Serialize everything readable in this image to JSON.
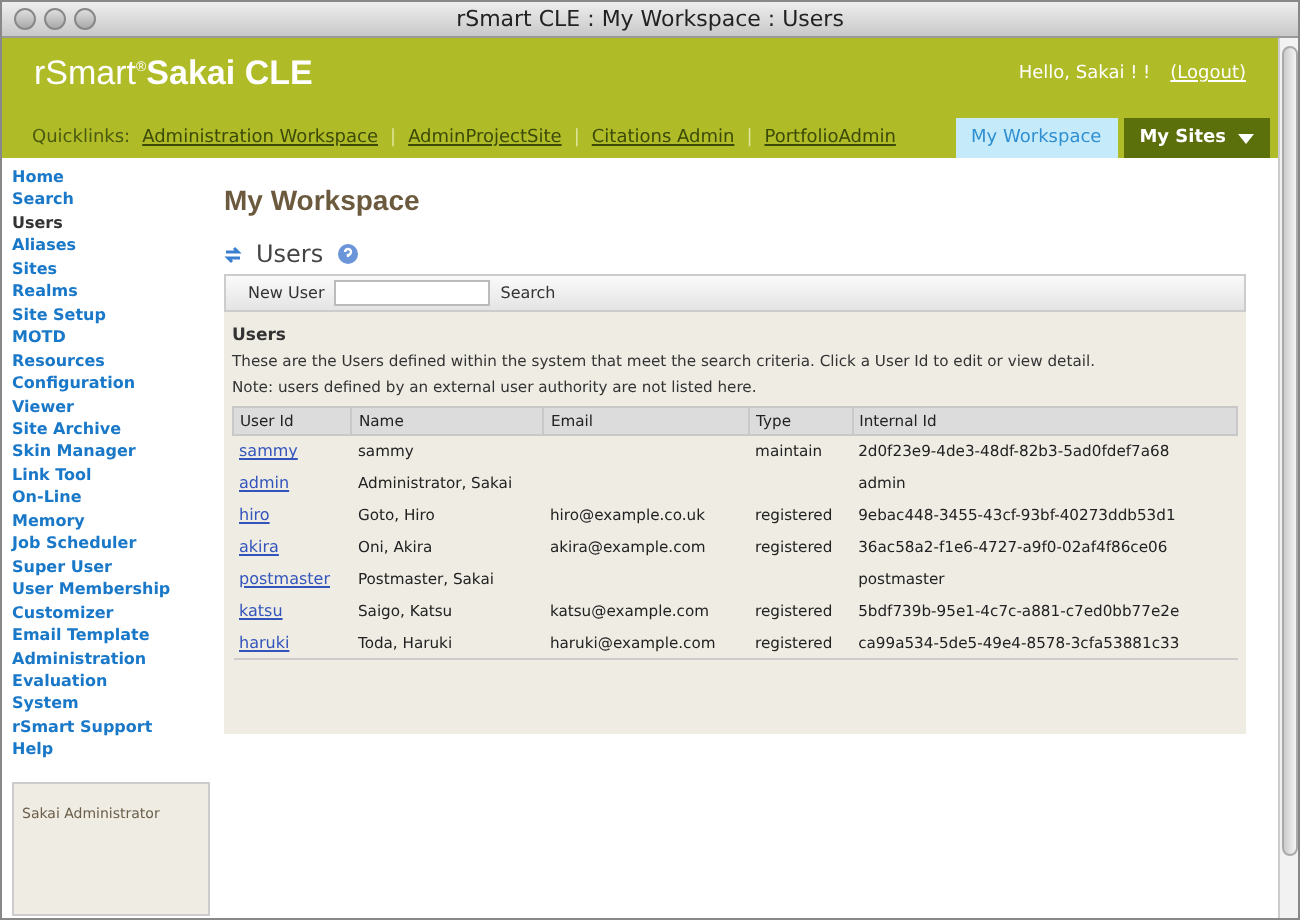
{
  "window": {
    "title": "rSmart CLE : My Workspace : Users"
  },
  "header": {
    "logo_light": "rSmart",
    "logo_mark": "®",
    "logo_bold": "Sakai CLE",
    "greeting": "Hello, Sakai ! !",
    "logout": "(Logout)"
  },
  "quicklinks": {
    "label": "Quicklinks:",
    "links": [
      "Administration Workspace",
      "AdminProjectSite",
      "Citations Admin",
      "PortfolioAdmin"
    ],
    "separator": "|"
  },
  "site_tabs": [
    {
      "label": "My Workspace",
      "selected": true,
      "caret": false
    },
    {
      "label": "My Sites",
      "selected": false,
      "caret": true
    }
  ],
  "sidebar": {
    "items": [
      {
        "label": "Home",
        "selected": false
      },
      {
        "label": "Search",
        "selected": false
      },
      {
        "label": "Users",
        "selected": true
      },
      {
        "label": "Aliases",
        "selected": false
      },
      {
        "label": "Sites",
        "selected": false
      },
      {
        "label": "Realms",
        "selected": false
      },
      {
        "label": "Site Setup",
        "selected": false
      },
      {
        "label": "MOTD",
        "selected": false
      },
      {
        "label": "Resources",
        "selected": false
      },
      {
        "label": "Configuration",
        "selected": false
      },
      {
        "label": "Viewer",
        "selected": false
      },
      {
        "label": "Site Archive",
        "selected": false
      },
      {
        "label": "Skin Manager",
        "selected": false
      },
      {
        "label": "Link Tool",
        "selected": false
      },
      {
        "label": "On-Line",
        "selected": false
      },
      {
        "label": "Memory",
        "selected": false
      },
      {
        "label": "Job Scheduler",
        "selected": false
      },
      {
        "label": "Super User",
        "selected": false
      },
      {
        "label": "User Membership",
        "selected": false
      },
      {
        "label": "Customizer",
        "selected": false
      },
      {
        "label": "Email Template",
        "selected": false
      },
      {
        "label": "Administration",
        "selected": false
      },
      {
        "label": "Evaluation",
        "selected": false
      },
      {
        "label": "System",
        "selected": false
      },
      {
        "label": "rSmart Support",
        "selected": false
      },
      {
        "label": "Help",
        "selected": false
      }
    ],
    "presence_title": "Sakai Administrator"
  },
  "page_title": "My Workspace",
  "tool": {
    "title": "Users",
    "toolbar": {
      "new_user": "New User",
      "search": "Search"
    },
    "section_title": "Users",
    "instructions": [
      "These are the Users defined within the system that meet the search criteria. Click a User Id to edit or view detail.",
      "Note: users defined by an external user authority are not listed here."
    ]
  },
  "table": {
    "columns": [
      "User Id",
      "Name",
      "Email",
      "Type",
      "Internal Id"
    ],
    "rows": [
      [
        "sammy",
        "sammy",
        "",
        "maintain",
        "2d0f23e9-4de3-48df-82b3-5ad0fdef7a68"
      ],
      [
        "admin",
        "Administrator, Sakai",
        "",
        "",
        "admin"
      ],
      [
        "hiro",
        "Goto, Hiro",
        "hiro@example.co.uk",
        "registered",
        "9ebac448-3455-43cf-93bf-40273ddb53d1"
      ],
      [
        "akira",
        "Oni, Akira",
        "akira@example.com",
        "registered",
        "36ac58a2-f1e6-4727-a9f0-02af4f86ce06"
      ],
      [
        "postmaster",
        "Postmaster, Sakai",
        "",
        "",
        "postmaster"
      ],
      [
        "katsu",
        "Saigo, Katsu",
        "katsu@example.com",
        "registered",
        "5bdf739b-95e1-4c7c-a881-c7ed0bb77e2e"
      ],
      [
        "haruki",
        "Toda, Haruki",
        "haruki@example.com",
        "registered",
        "ca99a534-5de5-49e4-8578-3cfa53881c33"
      ]
    ]
  }
}
